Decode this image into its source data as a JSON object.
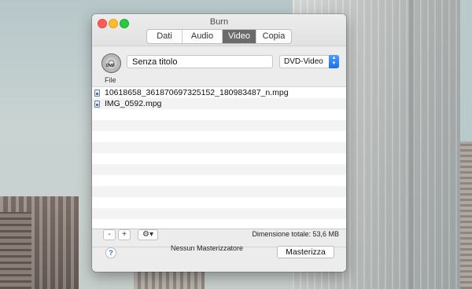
{
  "window": {
    "title": "Burn"
  },
  "tabs": [
    {
      "label": "Dati",
      "active": false
    },
    {
      "label": "Audio",
      "active": false
    },
    {
      "label": "Video",
      "active": true
    },
    {
      "label": "Copia",
      "active": false
    }
  ],
  "disc": {
    "name_value": "Senza titolo",
    "icon_label": "DVD",
    "icon": "disc-icon"
  },
  "format": {
    "selected": "DVD-Video"
  },
  "file_list": {
    "header": "File",
    "rows": [
      {
        "name": "10618658_361870697325152_180983487_n.mpg",
        "icon": "movie-file-icon"
      },
      {
        "name": "IMG_0592.mpg",
        "icon": "movie-file-icon"
      }
    ]
  },
  "toolbar": {
    "minus_label": "-",
    "plus_label": "+",
    "gear_label": "⚙▾",
    "total_size": "Dimensione totale: 53,6 MB"
  },
  "footer": {
    "help_label": "?",
    "recorder_status": "Nessun Masterizzatore",
    "burn_label": "Masterizza"
  },
  "colors": {
    "active_tab": "#6b6b6b",
    "select_accent": "#1d6ee8",
    "close": "#fc5f57",
    "minimize": "#fdbc2e",
    "maximize": "#2ac940"
  }
}
